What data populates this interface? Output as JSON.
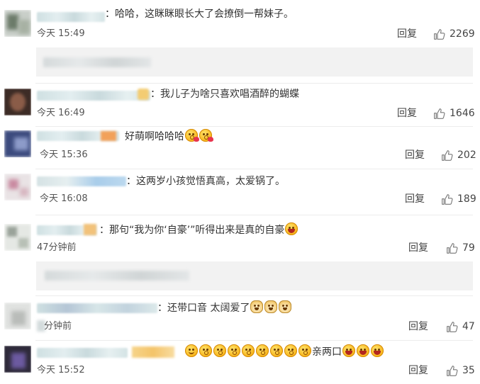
{
  "comments": [
    {
      "text": "：哈哈，这眯眯眼长大了会撩倒一帮妹子。",
      "time": "今天 15:49",
      "reply": "回复",
      "likes": "2269"
    },
    {
      "text": "：我儿子为啥只喜欢唱酒醉的蝴蝶",
      "time": "今天 16:49",
      "reply": "回复",
      "likes": "1646"
    },
    {
      "text": "好萌啊哈哈哈",
      "time": "今天 15:36",
      "reply": "回复",
      "likes": "202"
    },
    {
      "text": "：这两岁小孩觉悟真高，太爱锅了。",
      "time": "今天 16:08",
      "reply": "回复",
      "likes": "189"
    },
    {
      "text": "：那句“我为你‘自豪’”听得出来是真的自豪",
      "time": "47分钟前",
      "reply": "回复",
      "likes": "79"
    },
    {
      "text": "：还带口音  太阔爱了",
      "time": "分钟前",
      "reply": "回复",
      "likes": "47"
    },
    {
      "text": "亲两口",
      "time": "今天 15:52",
      "reply": "回复",
      "likes": "35"
    }
  ],
  "icons": {
    "like": "thumbs-up-icon",
    "laugh": "laughing-emoji-icon",
    "kiss": "kiss-emoji-icon",
    "smile": "smile-emoji-icon",
    "dog": "doge-emoji-icon"
  },
  "colors": {
    "text": "#333333",
    "meta": "#555555",
    "subreply_bg": "#f2f2f2",
    "separator": "#ececec"
  }
}
